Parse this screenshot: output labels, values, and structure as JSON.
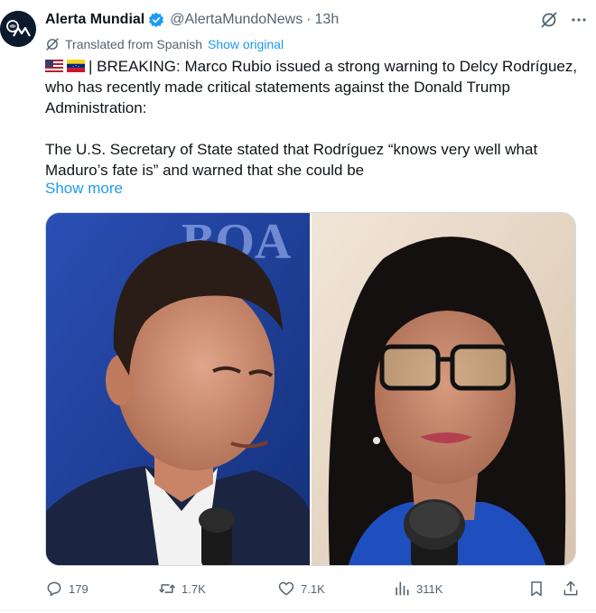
{
  "account": {
    "display_name": "Alerta Mundial",
    "handle": "@AlertaMundoNews",
    "separator": "·",
    "time": "13h"
  },
  "translation": {
    "label": "Translated from Spanish",
    "show_original": "Show original"
  },
  "tweet": {
    "paragraph1": "| BREAKING: Marco Rubio issued a strong warning to Delcy Rodríguez, who has recently made critical statements against the Donald Trump Administration:",
    "paragraph2": "The U.S. Secretary of State stated that Rodríguez “knows very well what Maduro’s fate is” and warned that she could be",
    "show_more": "Show more",
    "flags": [
      "us-flag-icon",
      "venezuela-flag-icon"
    ]
  },
  "media": {
    "photos": [
      "photo-marco-rubio",
      "photo-delcy-rodriguez"
    ],
    "background_text": "BOA"
  },
  "actions": {
    "replies": "179",
    "reposts": "1.7K",
    "likes": "7.1K",
    "views": "311K"
  },
  "colors": {
    "accent": "#1d9bf0",
    "text": "#0f1419",
    "secondary": "#536471",
    "verified": "#1d9bf0"
  },
  "icons": [
    "grok-icon",
    "more-icon",
    "translate-icon",
    "reply-icon",
    "repost-icon",
    "like-icon",
    "views-icon",
    "bookmark-icon",
    "share-icon"
  ]
}
